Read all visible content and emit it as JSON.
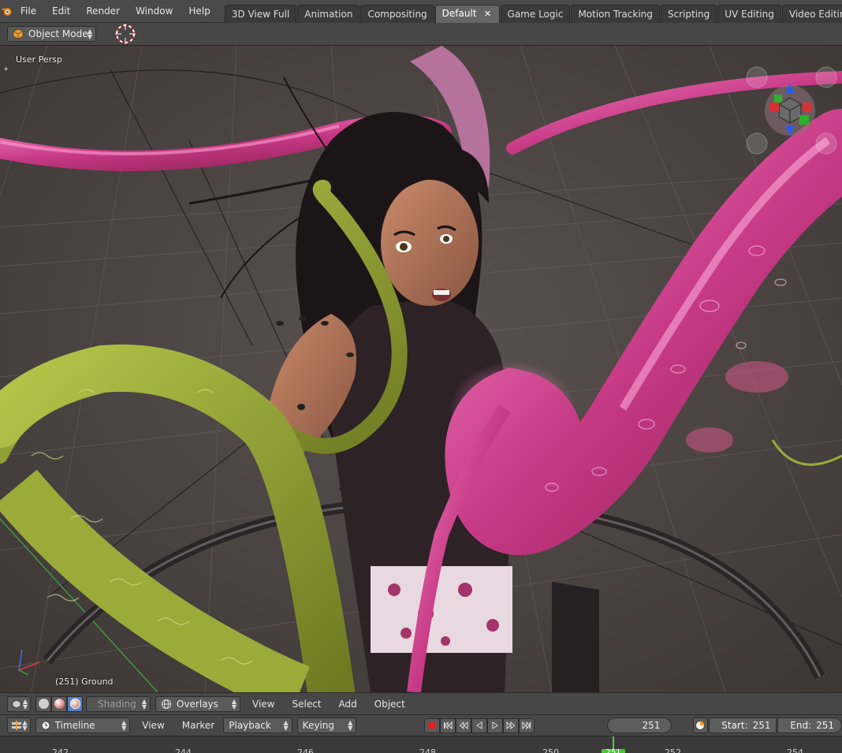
{
  "menu": [
    "File",
    "Edit",
    "Render",
    "Window",
    "Help"
  ],
  "workspaces": {
    "tabs": [
      "3D View Full",
      "Animation",
      "Compositing",
      "Default",
      "Game Logic",
      "Motion Tracking",
      "Scripting",
      "UV Editing",
      "Video Editing"
    ],
    "active": "Default"
  },
  "mode_selector": {
    "label": "Object Mode"
  },
  "viewport": {
    "view_label": "User Persp",
    "object_label": "(251) Ground"
  },
  "viewport_header": {
    "shading_label": "Shading",
    "overlays_label": "Overlays",
    "menu": [
      "View",
      "Select",
      "Add",
      "Object"
    ]
  },
  "timeline": {
    "editor_label": "Timeline",
    "menu": [
      "View",
      "Marker"
    ],
    "playback_label": "Playback",
    "keying_label": "Keying",
    "current_frame": "251",
    "start_label": "Start:",
    "start_value": "251",
    "end_label": "End:",
    "end_value": "251",
    "ruler_ticks": [
      "242",
      "244",
      "246",
      "248",
      "250",
      "252",
      "254"
    ],
    "playhead_label": "251"
  },
  "colors": {
    "tentacle_pink": "#c43f7a",
    "tentacle_green": "#9aab3a",
    "playhead": "#4ec33a",
    "record": "#e02020"
  }
}
